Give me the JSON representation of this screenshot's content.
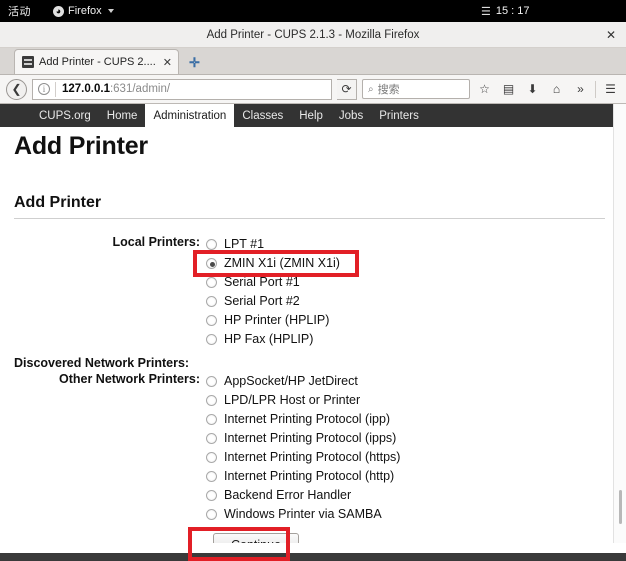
{
  "desktop": {
    "activities_label": "活动",
    "app_name": "Firefox",
    "app_icon": "firefox-icon",
    "menu_icon": "hamburger-icon",
    "clock": "15 : 17"
  },
  "window": {
    "title": "Add Printer - CUPS 2.1.3 - Mozilla Firefox",
    "close_label": "✕"
  },
  "browser": {
    "tab": {
      "favicon": "cups-favicon",
      "title": "Add Printer - CUPS 2....",
      "close_label": "✕"
    },
    "new_tab_label": "✛",
    "back_label": "❮",
    "info_label": "i",
    "url": {
      "host": "127.0.0.1",
      "path": ":631/admin/"
    },
    "reload_label": "⟳",
    "search": {
      "icon": "search-icon",
      "placeholder": "搜索",
      "value": ""
    },
    "toolbar_icons": [
      {
        "name": "bookmark-star-icon",
        "glyph": "☆"
      },
      {
        "name": "reader-view-icon",
        "glyph": "▤"
      },
      {
        "name": "downloads-icon",
        "glyph": "⬇"
      },
      {
        "name": "home-icon",
        "glyph": "⌂"
      },
      {
        "name": "overflow-chevron-icon",
        "glyph": "»"
      },
      {
        "name": "app-menu-icon",
        "glyph": "☰"
      }
    ]
  },
  "cups": {
    "nav": [
      {
        "label": "CUPS.org",
        "active": false
      },
      {
        "label": "Home",
        "active": false
      },
      {
        "label": "Administration",
        "active": true
      },
      {
        "label": "Classes",
        "active": false
      },
      {
        "label": "Help",
        "active": false
      },
      {
        "label": "Jobs",
        "active": false
      },
      {
        "label": "Printers",
        "active": false
      }
    ],
    "page_title": "Add Printer",
    "section_title": "Add Printer",
    "local_printers": {
      "label": "Local Printers:",
      "options": [
        {
          "label": "LPT #1",
          "checked": false
        },
        {
          "label": "ZMIN X1i (ZMIN X1i)",
          "checked": true
        },
        {
          "label": "Serial Port #1",
          "checked": false
        },
        {
          "label": "Serial Port #2",
          "checked": false
        },
        {
          "label": "HP Printer (HPLIP)",
          "checked": false
        },
        {
          "label": "HP Fax (HPLIP)",
          "checked": false
        }
      ]
    },
    "discovered_network_printers": {
      "label": "Discovered Network Printers:",
      "options": []
    },
    "other_network_printers": {
      "label": "Other Network Printers:",
      "options": [
        {
          "label": "AppSocket/HP JetDirect",
          "checked": false
        },
        {
          "label": "LPD/LPR Host or Printer",
          "checked": false
        },
        {
          "label": "Internet Printing Protocol (ipp)",
          "checked": false
        },
        {
          "label": "Internet Printing Protocol (ipps)",
          "checked": false
        },
        {
          "label": "Internet Printing Protocol (https)",
          "checked": false
        },
        {
          "label": "Internet Printing Protocol (http)",
          "checked": false
        },
        {
          "label": "Backend Error Handler",
          "checked": false
        },
        {
          "label": "Windows Printer via SAMBA",
          "checked": false
        }
      ]
    },
    "continue_label": "Continue"
  },
  "annotations": {
    "highlight_color": "#e21f26",
    "boxes": [
      {
        "name": "selected-printer-highlight",
        "target": "ZMIN X1i (ZMIN X1i)"
      },
      {
        "name": "continue-button-highlight",
        "target": "Continue"
      }
    ]
  }
}
